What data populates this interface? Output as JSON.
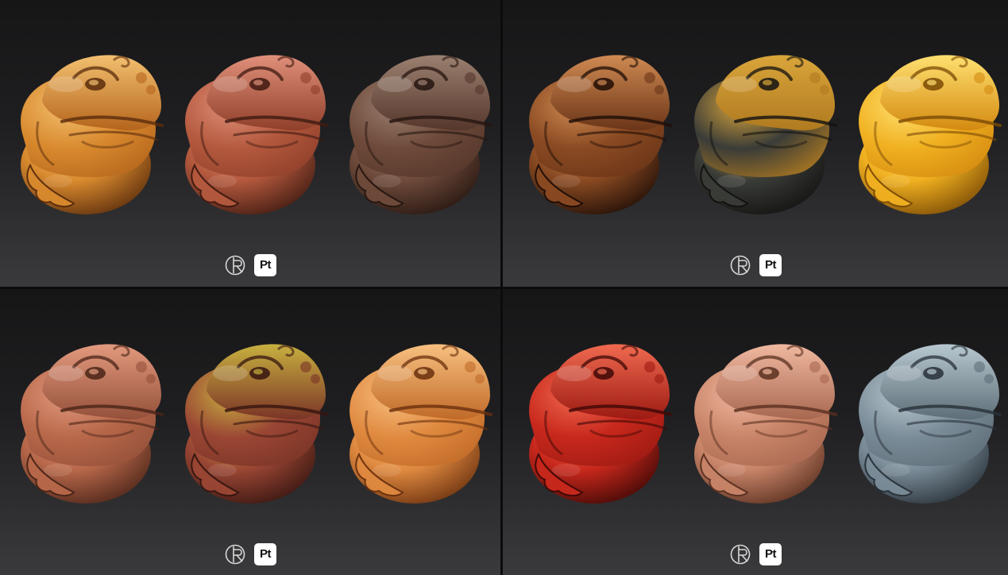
{
  "panels": [
    {
      "materials": [
        {
          "name": "light-amber-wood",
          "base": "#d98a2e",
          "mid": "#b5651c",
          "dark": "#5a2c0c",
          "light": "#f3c070"
        },
        {
          "name": "rosewood",
          "base": "#b4593e",
          "mid": "#8f3f2a",
          "dark": "#3f1a10",
          "light": "#e0907a"
        },
        {
          "name": "mossy-dark-wood",
          "base": "#6e4a3a",
          "mid": "#55372b",
          "dark": "#251510",
          "light": "#9b8070"
        }
      ],
      "badge": "Pt"
    },
    {
      "materials": [
        {
          "name": "copper-metal",
          "base": "#8a4a22",
          "mid": "#6a3518",
          "dark": "#1e0d06",
          "light": "#d08a52"
        },
        {
          "name": "dark-gold-patina",
          "base": "#3a3c38",
          "mid": "#b07a20",
          "dark": "#121210",
          "light": "#d9a53a"
        },
        {
          "name": "polished-gold",
          "base": "#f0b020",
          "mid": "#d48a10",
          "dark": "#7a4a05",
          "light": "#ffe070"
        }
      ],
      "badge": "Pt"
    },
    {
      "materials": [
        {
          "name": "clay-brown",
          "base": "#b8684a",
          "mid": "#94503a",
          "dark": "#4a2418",
          "light": "#e39a7e"
        },
        {
          "name": "mossy-mahogany",
          "base": "#9a4634",
          "mid": "#7a3426",
          "dark": "#361510",
          "light": "#c8b040"
        },
        {
          "name": "honey-pine",
          "base": "#e08a40",
          "mid": "#c06a28",
          "dark": "#6a300e",
          "light": "#f8c080"
        }
      ],
      "badge": "Pt"
    },
    {
      "materials": [
        {
          "name": "red-lacquer",
          "base": "#c8281c",
          "mid": "#9c1a12",
          "dark": "#3e0806",
          "light": "#f06a50"
        },
        {
          "name": "pale-terracotta",
          "base": "#c88468",
          "mid": "#a86850",
          "dark": "#5a3020",
          "light": "#f0b8a0"
        },
        {
          "name": "weathered-blue-gray-wood",
          "base": "#7a8c98",
          "mid": "#5e6e78",
          "dark": "#283038",
          "light": "#b8c8d0"
        }
      ],
      "badge": "Pt"
    }
  ]
}
